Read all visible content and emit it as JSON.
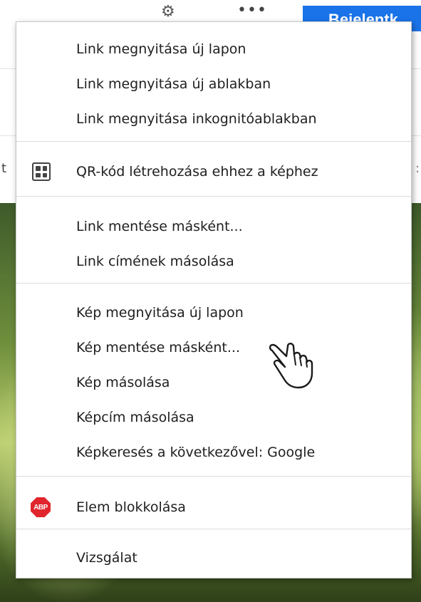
{
  "background": {
    "gear_icon": "gear-icon",
    "more_icon": "•••",
    "blue_button_label": "Bejelentk",
    "edge_text_left": "t",
    "edge_text_right": ":"
  },
  "context_menu": {
    "groups": [
      {
        "items": [
          {
            "label": "Link megnyitása új lapon"
          },
          {
            "label": "Link megnyitása új ablakban"
          },
          {
            "label": "Link megnyitása inkognitóablakban"
          }
        ]
      },
      {
        "items": [
          {
            "label": "QR-kód létrehozása ehhez a képhez",
            "icon": "qr-code-icon"
          }
        ]
      },
      {
        "items": [
          {
            "label": "Link mentése másként..."
          },
          {
            "label": "Link címének másolása"
          }
        ]
      },
      {
        "items": [
          {
            "label": "Kép megnyitása új lapon"
          },
          {
            "label": "Kép mentése másként..."
          },
          {
            "label": "Kép másolása"
          },
          {
            "label": "Képcím másolása"
          },
          {
            "label": "Képkeresés a következővel: Google"
          }
        ]
      },
      {
        "items": [
          {
            "label": "Elem blokkolása",
            "icon": "abp-icon",
            "icon_text": "ABP"
          }
        ]
      },
      {
        "items": [
          {
            "label": "Vizsgálat"
          }
        ]
      }
    ]
  },
  "colors": {
    "menu_text": "#202020",
    "separator": "#dcdcdc",
    "abp_red": "#e0262c",
    "browser_blue": "#1a73e8"
  }
}
